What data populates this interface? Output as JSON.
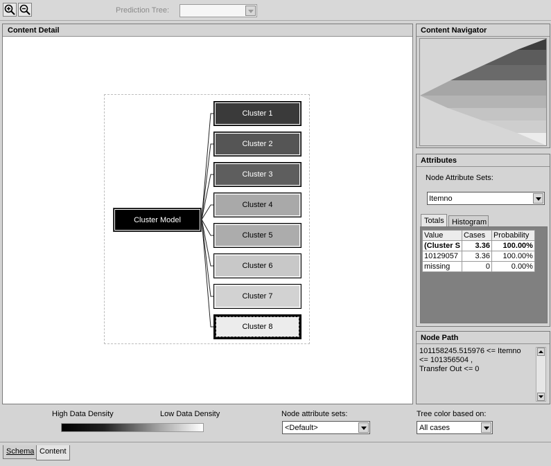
{
  "toolbar": {
    "prediction_tree_label": "Prediction Tree:",
    "prediction_tree_value": "",
    "zoom_in_icon": "zoom-in-icon",
    "zoom_out_icon": "zoom-out-icon"
  },
  "content_detail": {
    "title": "Content Detail",
    "model_label": "Cluster Model",
    "clusters": [
      {
        "label": "Cluster 1",
        "color": "#3a3a3a",
        "text_color": "#ffffff"
      },
      {
        "label": "Cluster 2",
        "color": "#555555",
        "text_color": "#ffffff"
      },
      {
        "label": "Cluster 3",
        "color": "#5e5e5e",
        "text_color": "#ffffff"
      },
      {
        "label": "Cluster 4",
        "color": "#a9a9a9",
        "text_color": "#000000"
      },
      {
        "label": "Cluster 5",
        "color": "#acacac",
        "text_color": "#000000"
      },
      {
        "label": "Cluster 6",
        "color": "#c8c8c8",
        "text_color": "#000000"
      },
      {
        "label": "Cluster 7",
        "color": "#d2d2d2",
        "text_color": "#000000"
      },
      {
        "label": "Cluster 8",
        "color": "#ececec",
        "text_color": "#000000"
      }
    ]
  },
  "navigator": {
    "title": "Content Navigator"
  },
  "attributes": {
    "title": "Attributes",
    "node_attribute_sets_label": "Node Attribute Sets:",
    "node_attribute_sets_value": "Itemno",
    "tabs": [
      {
        "label": "Totals"
      },
      {
        "label": "Histogram"
      }
    ],
    "columns": [
      "Value",
      "Cases",
      "Probability"
    ],
    "rows": [
      {
        "value": "(Cluster S",
        "cases": "3.36",
        "probability": "100.00%"
      },
      {
        "value": "10129057",
        "cases": "3.36",
        "probability": "100.00%"
      },
      {
        "value": "missing",
        "cases": "0",
        "probability": "0.00%"
      }
    ]
  },
  "node_path": {
    "title": "Node Path",
    "lines": [
      "101158245.515976 <= Itemno",
      "<= 101356504 ,",
      "Transfer Out <= 0"
    ]
  },
  "bottom": {
    "high_density_label": "High Data Density",
    "low_density_label": "Low Data Density",
    "node_attribute_sets_label": "Node attribute sets:",
    "node_attribute_sets_value": "<Default>",
    "tree_color_label": "Tree color based on:",
    "tree_color_value": "All cases"
  },
  "bottom_tabs": [
    {
      "label": "Schema"
    },
    {
      "label": "Content"
    }
  ]
}
